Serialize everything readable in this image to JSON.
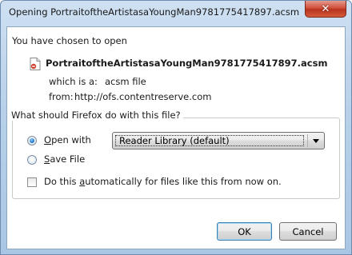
{
  "window": {
    "title": "Opening PortraitoftheArtistasaYoungMan9781775417897.acsm"
  },
  "dialog": {
    "intro": "You have chosen to open",
    "file_name": "PortraitoftheArtistasaYoungMan9781775417897.acsm",
    "which_is_label": "which is a:",
    "which_is_value": "acsm file",
    "from_label": "from:",
    "from_value": "http://ofs.contentreserve.com",
    "question": "What should Firefox do with this file?",
    "open_with": {
      "mnemonic": "O",
      "rest": "pen with",
      "selected": true
    },
    "app_select": {
      "value": "Reader Library (default)"
    },
    "save_file": {
      "mnemonic": "S",
      "rest": "ave File",
      "selected": false
    },
    "auto": {
      "before": "Do this ",
      "mnemonic": "a",
      "after": "utomatically for files like this from now on.",
      "checked": false
    },
    "ok_label": "OK",
    "cancel_label": "Cancel"
  },
  "colors": {
    "frame": "#b9d1ea",
    "close_button": "#cf4f3b",
    "radio_selected": "#2a7fd4"
  },
  "icons": {
    "close": "close-icon",
    "file": "acsm-file-icon",
    "dropdown": "chevron-down-icon"
  }
}
